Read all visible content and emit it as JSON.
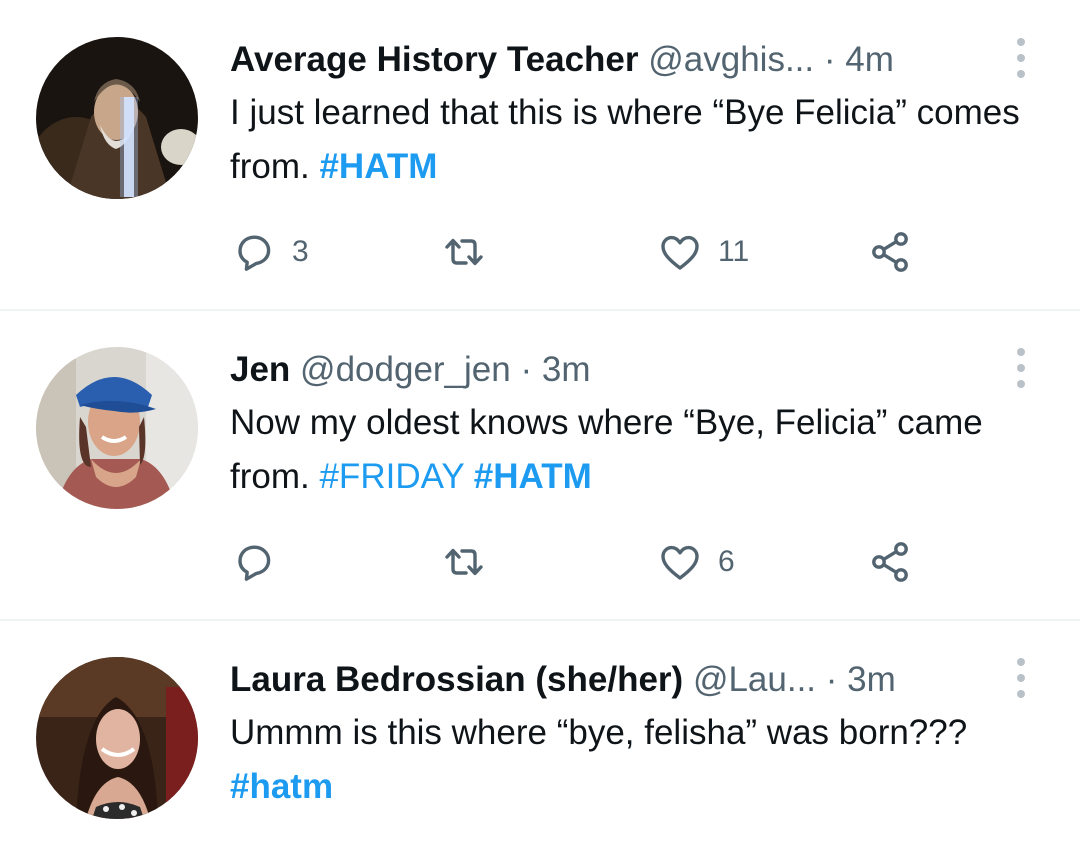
{
  "tweets": [
    {
      "name": "Average History Teacher",
      "handle": "@avghis...",
      "dot": "·",
      "time": "4m",
      "text_plain": "I just learned that this is where “Bye Felicia” comes from.",
      "tags": [
        "#HATM"
      ],
      "replies": "3",
      "likes": "11"
    },
    {
      "name": "Jen",
      "handle": "@dodger_jen",
      "dot": "·",
      "time": "3m",
      "text_plain": "Now my oldest knows where “Bye, Felicia” came from.",
      "tags": [
        "#FRIDAY",
        "#HATM"
      ],
      "replies": "",
      "likes": "6"
    },
    {
      "name": "Laura Bedrossian (she/her)",
      "handle": "@Lau...",
      "dot": "·",
      "time": "3m",
      "text_plain": "Ummm is this where “bye, felisha”  was born???",
      "tags": [
        "#hatm"
      ]
    }
  ],
  "icons": {
    "reply": "reply-icon",
    "retweet": "retweet-icon",
    "like": "heart-icon",
    "share": "share-icon",
    "more": "more-vertical-icon"
  },
  "colors": {
    "link": "#1d9bf0",
    "secondary": "#536471",
    "text": "#0f1419",
    "divider": "#eff3f4"
  }
}
